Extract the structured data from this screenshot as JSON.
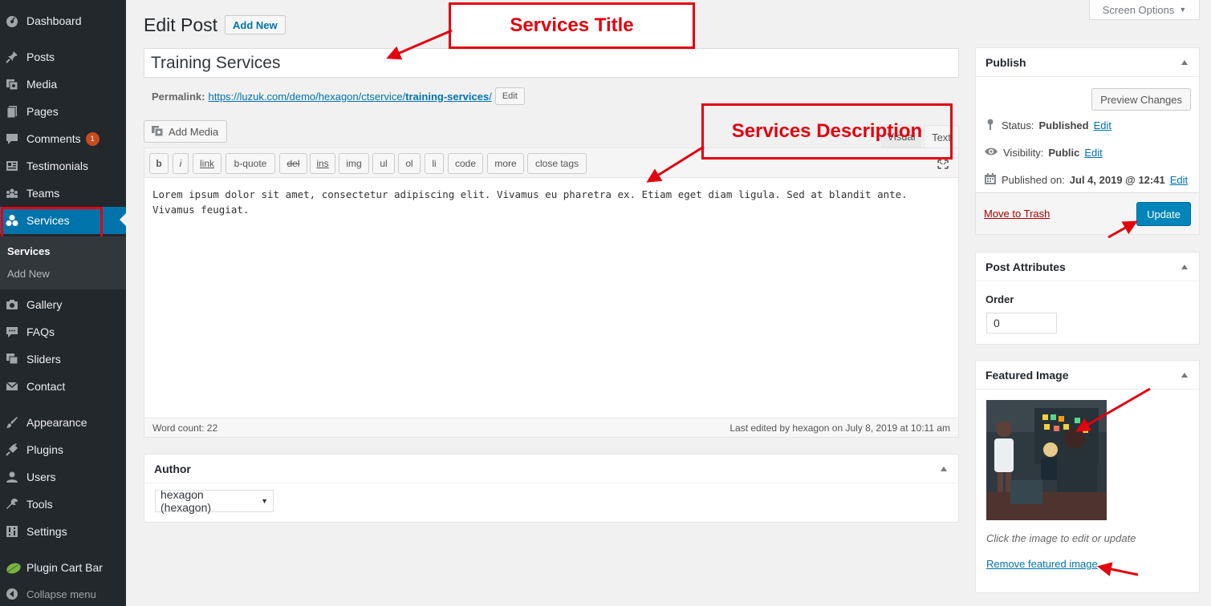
{
  "sidebar": {
    "items": [
      {
        "id": "dashboard",
        "label": "Dashboard",
        "icon": "dashboard-icon"
      },
      {
        "id": "posts",
        "label": "Posts",
        "icon": "pin-icon"
      },
      {
        "id": "media",
        "label": "Media",
        "icon": "media-icon"
      },
      {
        "id": "pages",
        "label": "Pages",
        "icon": "pages-icon"
      },
      {
        "id": "comments",
        "label": "Comments",
        "icon": "comment-icon",
        "badge": "1"
      },
      {
        "id": "testimonials",
        "label": "Testimonials",
        "icon": "testimonial-icon"
      },
      {
        "id": "teams",
        "label": "Teams",
        "icon": "group-icon"
      },
      {
        "id": "services",
        "label": "Services",
        "icon": "services-icon",
        "active": true
      },
      {
        "id": "gallery",
        "label": "Gallery",
        "icon": "camera-icon"
      },
      {
        "id": "faqs",
        "label": "FAQs",
        "icon": "faq-icon"
      },
      {
        "id": "sliders",
        "label": "Sliders",
        "icon": "slider-icon"
      },
      {
        "id": "contact",
        "label": "Contact",
        "icon": "mail-icon"
      },
      {
        "id": "appearance",
        "label": "Appearance",
        "icon": "brush-icon"
      },
      {
        "id": "plugins",
        "label": "Plugins",
        "icon": "plugin-icon"
      },
      {
        "id": "users",
        "label": "Users",
        "icon": "user-icon"
      },
      {
        "id": "tools",
        "label": "Tools",
        "icon": "wrench-icon"
      },
      {
        "id": "settings",
        "label": "Settings",
        "icon": "settings-icon"
      },
      {
        "id": "plugin_cart_bar",
        "label": "Plugin Cart Bar",
        "icon": "leaf-icon"
      }
    ],
    "submenu": [
      "Services",
      "Add New"
    ],
    "collapse_label": "Collapse menu"
  },
  "header": {
    "screen_options": "Screen Options",
    "title": "Edit Post",
    "add_new": "Add New"
  },
  "post": {
    "title": "Training Services",
    "permalink_label": "Permalink:",
    "permalink_base": "https://luzuk.com/demo/hexagon/ctservice/",
    "permalink_slug": "training-services",
    "permalink_end": "/",
    "permalink_edit": "Edit"
  },
  "editor": {
    "add_media": "Add Media",
    "tab_visual": "Visual",
    "tab_text": "Text",
    "quicktags": [
      "b",
      "i",
      "link",
      "b-quote",
      "del",
      "ins",
      "img",
      "ul",
      "ol",
      "li",
      "code",
      "more",
      "close tags"
    ],
    "content_line1": "Lorem ipsum dolor sit amet, consectetur adipiscing elit. Vivamus eu pharetra ex. Etiam eget diam ligula. Sed at blandit ante.",
    "content_line2": "Vivamus feugiat.",
    "word_count": "Word count: 22",
    "last_edited": "Last edited by hexagon on July 8, 2019 at 10:11 am"
  },
  "author_box": {
    "title": "Author",
    "selected": "hexagon (hexagon)"
  },
  "publish": {
    "title": "Publish",
    "preview": "Preview Changes",
    "status_label": "Status:",
    "status_value": "Published",
    "visibility_label": "Visibility:",
    "visibility_value": "Public",
    "published_label": "Published on:",
    "published_value": "Jul 4, 2019 @ 12:41",
    "edit": "Edit",
    "trash": "Move to Trash",
    "update": "Update"
  },
  "attributes": {
    "title": "Post Attributes",
    "order_label": "Order",
    "order_value": "0"
  },
  "featured": {
    "title": "Featured Image",
    "hint": "Click the image to edit or update",
    "remove": "Remove featured image"
  },
  "annotations": {
    "title_callout": "Services Title",
    "description_callout": "Services Description"
  },
  "colors": {
    "accent": "#0073aa",
    "annotation": "#e3000f",
    "sidebar_bg": "#23282d"
  }
}
